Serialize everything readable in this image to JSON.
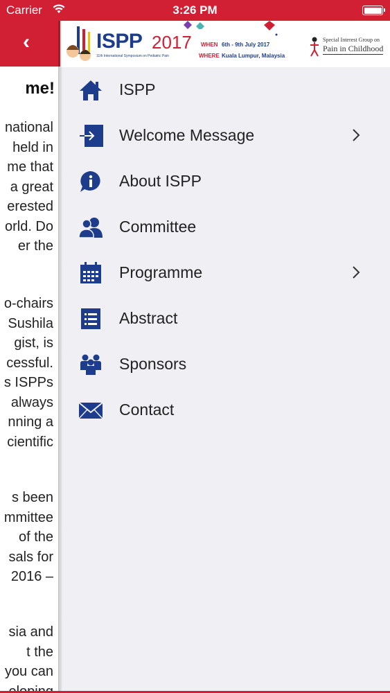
{
  "status_bar": {
    "carrier": "Carrier",
    "time": "3:26 PM",
    "wifi_icon": "wifi-icon",
    "battery_icon": "battery-icon"
  },
  "background_page": {
    "title": "me!",
    "paragraphs": [
      [
        "national",
        "held in",
        "me that",
        "a great",
        "erested",
        "orld. Do",
        "er  the"
      ],
      [
        "o-chairs",
        "Sushila",
        "gist, is",
        "cessful.",
        "s ISPPs",
        "always",
        "nning a",
        "cientific"
      ],
      [
        "s  been",
        "mmittee",
        "of  the",
        "sals for",
        "2016 –"
      ],
      [
        "sia and",
        "t  the",
        "you can",
        "eloping"
      ]
    ]
  },
  "banner": {
    "logo_text": "ISPP",
    "logo_year": "2017",
    "logo_subtitle": "11th International Symposium on Pediatric Pain",
    "when_label": "WHEN",
    "when_value": "6th - 9th July 2017",
    "where_label": "WHERE",
    "where_value": "Kuala Lumpur, Malaysia",
    "sig_line1": "Special Interest Group on",
    "sig_line2": "Pain in Childhood"
  },
  "menu": {
    "items": [
      {
        "label": "ISPP",
        "icon": "home-icon",
        "has_chevron": false
      },
      {
        "label": "Welcome Message",
        "icon": "sign-in-icon",
        "has_chevron": true
      },
      {
        "label": "About ISPP",
        "icon": "info-icon",
        "has_chevron": false
      },
      {
        "label": "Committee",
        "icon": "users-icon",
        "has_chevron": false
      },
      {
        "label": "Programme",
        "icon": "calendar-icon",
        "has_chevron": true
      },
      {
        "label": "Abstract",
        "icon": "list-icon",
        "has_chevron": false
      },
      {
        "label": "Sponsors",
        "icon": "group-icon",
        "has_chevron": false
      },
      {
        "label": "Contact",
        "icon": "mail-icon",
        "has_chevron": false
      }
    ]
  },
  "colors": {
    "brand_red": "#d11f33",
    "icon_navy": "#1d3c8c",
    "drawer_bg": "#efeff4"
  }
}
